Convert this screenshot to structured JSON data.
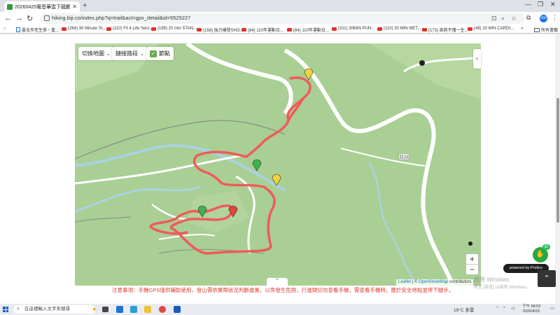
{
  "browser": {
    "tab_title": "20260425電音華雲下龍鸝溢引",
    "new_tab_symbol": "+",
    "url": "hiking.biji.co/index.php?q=trail&act=gpx_detail&id=5525227",
    "bookmarks": [
      {
        "label": "臺北市老生寧・重...",
        "icon": "doc"
      },
      {
        "label": "(264) 30 Minute St...",
        "icon": "youtube"
      },
      {
        "label": "(110) Fit 4 Life Seni...",
        "icon": "youtube"
      },
      {
        "label": "(189) 20 min STAN...",
        "icon": "youtube"
      },
      {
        "label": "(158) 強力爆發SHO...",
        "icon": "youtube"
      },
      {
        "label": "(84) 110年運動日...",
        "icon": "youtube"
      },
      {
        "label": "(84) 110年運動日...",
        "icon": "youtube"
      },
      {
        "label": "(311) 30MIN PUN...",
        "icon": "youtube"
      },
      {
        "label": "(110) 30 MIN MET...",
        "icon": "youtube"
      },
      {
        "label": "(173) 巫將不僅一生...",
        "icon": "youtube"
      },
      {
        "label": "(48) 20 MIN CARDI...",
        "icon": "youtube"
      }
    ],
    "bookmarks_overflow": "»",
    "all_bookmarks": "所有書籤"
  },
  "map": {
    "switch_map_label": "切換地圖",
    "relay_route_label": "鏈接路段",
    "waypoint_label": "節點",
    "zoom_in": "+",
    "zoom_out": "−",
    "attribution_leaflet": "Leaflet",
    "attribution_sep": " | © ",
    "attribution_osm": "OpenStreetMap",
    "attribution_tail": " contributors",
    "collapse_symbol": "⌃",
    "side_toggle_symbol": "‹",
    "road_label": "北33",
    "route_color": "#ef5b5b"
  },
  "notice": "注意事項：手機GPS僅供輔助使用，登山需依實際狀況判斷處置，以免發生危險，行進間切勿查看手機，需查看手機時，應於安全地點並停下腳步。",
  "widgets": {
    "chat_badge": "91",
    "protico_label": "powered by Protico",
    "back_to_top": "⌃",
    "watermark_title": "啟用 Windows",
    "watermark_sub": "移至 [設定] 以啟用 Windows。"
  },
  "taskbar": {
    "search_placeholder": "在這裡輸入文字來搜尋",
    "weather": "19°C 多雲",
    "time": "下午 08:53",
    "date": "2026/4/25"
  }
}
